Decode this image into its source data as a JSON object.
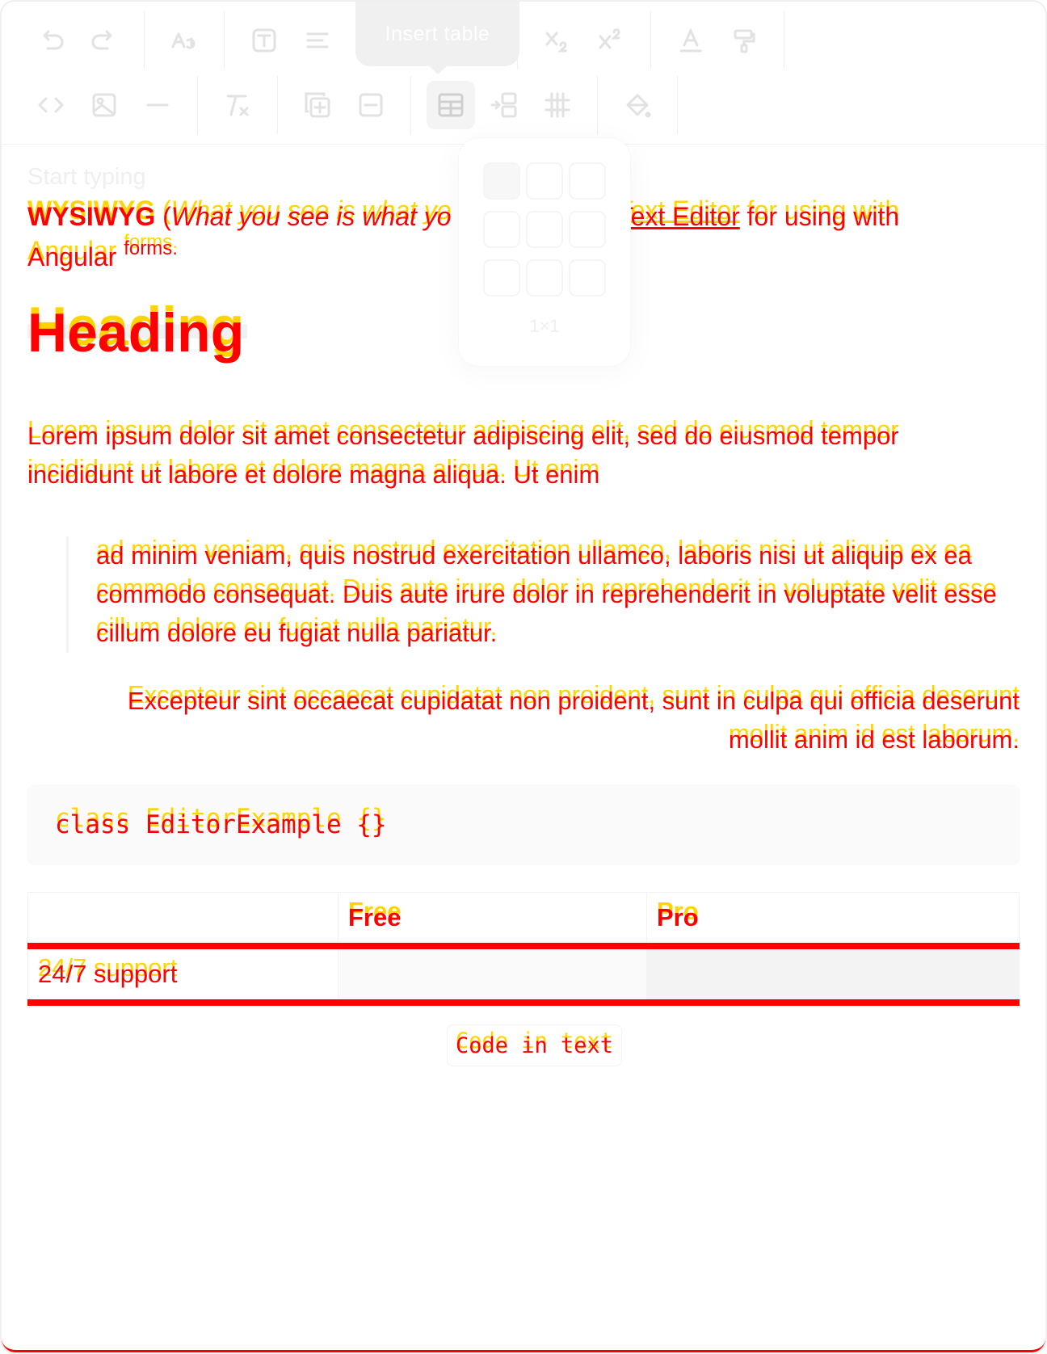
{
  "toolbar": {
    "tooltip": "Insert table",
    "row1": [
      "undo-icon",
      "redo-icon",
      "font-size-icon",
      "text-style-icon",
      "align-icon",
      "insert-table-icon",
      "link-icon",
      "anchor-icon",
      "subscript-icon",
      "superscript-icon",
      "text-color-icon",
      "paint-format-icon"
    ],
    "row2": [
      "code-icon",
      "image-icon",
      "horizontal-rule-icon",
      "clear-format-icon",
      "add-row-icon",
      "remove-icon",
      "table-icon",
      "add-column-icon",
      "table-grid-icon",
      "fill-color-icon"
    ]
  },
  "table_picker": {
    "size_label": "1×1"
  },
  "editor": {
    "placeholder": "Start typing",
    "p1": {
      "bold": "WYSIWYG",
      "space_paren": " (",
      "italic": "What you see is what yo",
      "link": "Text Editor",
      "rest": " for using with",
      "line2": "Angular",
      "forms": "forms."
    },
    "heading": "Heading",
    "para": "Lorem ipsum dolor sit amet consectetur adipiscing elit, sed do eiusmod tempor incididunt ut labore et dolore magna aliqua. Ut enim",
    "quote": "ad minim veniam, quis nostrud exercitation ullamco, laboris nisi ut aliquip ex ea commodo consequat. Duis aute irure dolor in reprehenderit in voluptate velit esse cillum dolore eu fugiat nulla pariatur.",
    "right_text": "Excepteur sint occaecat cupidatat non proident, sunt in culpa qui officia deserunt mollit anim id est laborum.",
    "code_block": "class EditorExample {}",
    "table": {
      "headers": [
        "",
        "Free",
        "Pro"
      ],
      "rows": [
        [
          "24/7 support",
          "",
          ""
        ]
      ]
    },
    "inline_code": "Code in text"
  }
}
